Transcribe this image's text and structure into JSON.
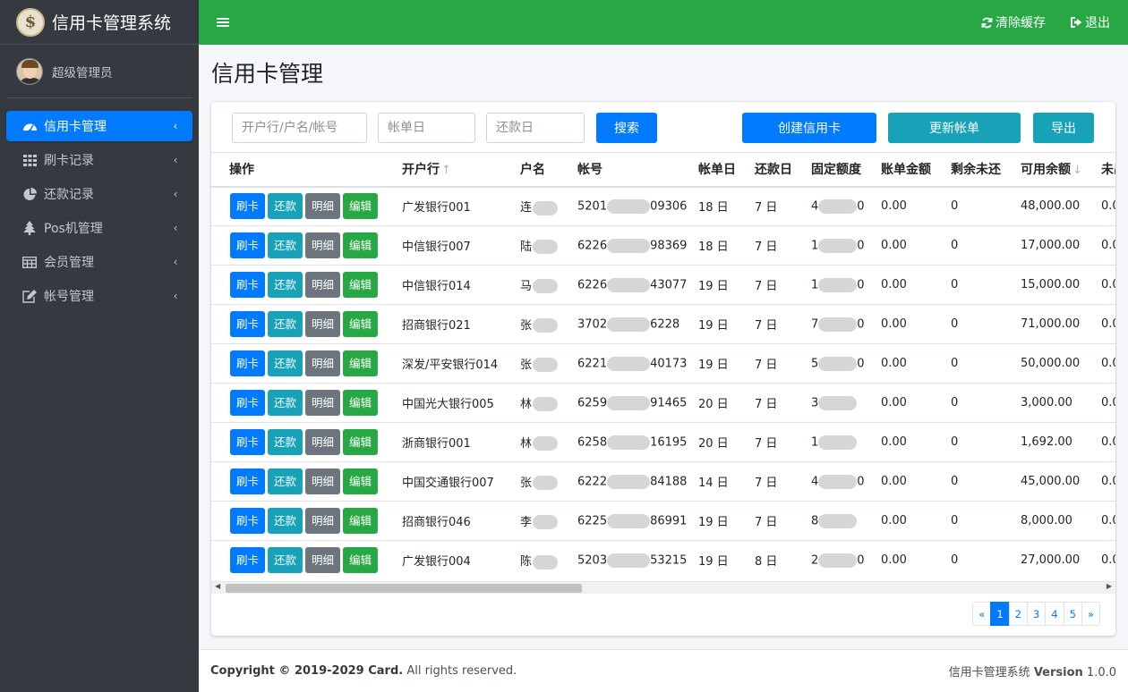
{
  "brand": {
    "title": "信用卡管理系统",
    "logo_icon": "brand-seal-icon"
  },
  "user": {
    "name": "超级管理员"
  },
  "sidebar": {
    "items": [
      {
        "label": "信用卡管理",
        "icon": "dashboard-icon",
        "active": true
      },
      {
        "label": "刷卡记录",
        "icon": "grid-icon",
        "active": false
      },
      {
        "label": "还款记录",
        "icon": "pie-chart-icon",
        "active": false
      },
      {
        "label": "Pos机管理",
        "icon": "tree-icon",
        "active": false
      },
      {
        "label": "会员管理",
        "icon": "table-icon",
        "active": false
      },
      {
        "label": "帐号管理",
        "icon": "edit-icon",
        "active": false
      }
    ]
  },
  "topbar": {
    "clear_cache": "清除缓存",
    "logout": "退出"
  },
  "page": {
    "title": "信用卡管理"
  },
  "toolbar": {
    "search_placeholder": "开户行/户名/帐号",
    "bill_day_placeholder": "帐单日",
    "repay_day_placeholder": "还款日",
    "search_label": "搜索",
    "create_label": "创建信用卡",
    "update_label": "更新帐单",
    "export_label": "导出"
  },
  "table": {
    "headers": [
      "操作",
      "开户行",
      "户名",
      "帐号",
      "帐单日",
      "还款日",
      "固定额度",
      "账单金额",
      "剩余未还",
      "可用余额",
      "未出"
    ],
    "actions": [
      "刷卡",
      "还款",
      "明细",
      "编辑"
    ],
    "rows": [
      {
        "bank": "广发银行001",
        "name": "连",
        "acct_a": "5201",
        "acct_b": "09306",
        "bill_day": "18 日",
        "repay_day": "7 日",
        "limit_a": "4",
        "limit_b": "0",
        "bill_amount": "0.00",
        "remaining": "0",
        "available": "48,000.00",
        "unbilled": "0.0"
      },
      {
        "bank": "中信银行007",
        "name": "陆",
        "acct_a": "6226",
        "acct_b": "98369",
        "bill_day": "18 日",
        "repay_day": "7 日",
        "limit_a": "1",
        "limit_b": "0",
        "bill_amount": "0.00",
        "remaining": "0",
        "available": "17,000.00",
        "unbilled": "0.0"
      },
      {
        "bank": "中信银行014",
        "name": "马",
        "acct_a": "6226",
        "acct_b": "43077",
        "bill_day": "19 日",
        "repay_day": "7 日",
        "limit_a": "1",
        "limit_b": "0",
        "bill_amount": "0.00",
        "remaining": "0",
        "available": "15,000.00",
        "unbilled": "0.0"
      },
      {
        "bank": "招商银行021",
        "name": "张",
        "acct_a": "3702",
        "acct_b": "6228",
        "bill_day": "19 日",
        "repay_day": "7 日",
        "limit_a": "7",
        "limit_b": "0",
        "bill_amount": "0.00",
        "remaining": "0",
        "available": "71,000.00",
        "unbilled": "0.0"
      },
      {
        "bank": "深发/平安银行014",
        "name": "张",
        "acct_a": "6221",
        "acct_b": "40173",
        "bill_day": "19 日",
        "repay_day": "7 日",
        "limit_a": "5",
        "limit_b": "0",
        "bill_amount": "0.00",
        "remaining": "0",
        "available": "50,000.00",
        "unbilled": "0.0"
      },
      {
        "bank": "中国光大银行005",
        "name": "林",
        "acct_a": "6259",
        "acct_b": "91465",
        "bill_day": "20 日",
        "repay_day": "7 日",
        "limit_a": "3",
        "limit_b": "",
        "bill_amount": "0.00",
        "remaining": "0",
        "available": "3,000.00",
        "unbilled": "0.0"
      },
      {
        "bank": "浙商银行001",
        "name": "林",
        "acct_a": "6258",
        "acct_b": "16195",
        "bill_day": "20 日",
        "repay_day": "7 日",
        "limit_a": "1",
        "limit_b": "",
        "bill_amount": "0.00",
        "remaining": "0",
        "available": "1,692.00",
        "unbilled": "0.0"
      },
      {
        "bank": "中国交通银行007",
        "name": "张",
        "acct_a": "6222",
        "acct_b": "84188",
        "bill_day": "14 日",
        "repay_day": "7 日",
        "limit_a": "4",
        "limit_b": "0",
        "bill_amount": "0.00",
        "remaining": "0",
        "available": "45,000.00",
        "unbilled": "0.0"
      },
      {
        "bank": "招商银行046",
        "name": "李",
        "acct_a": "6225",
        "acct_b": "86991",
        "bill_day": "19 日",
        "repay_day": "7 日",
        "limit_a": "8",
        "limit_b": "",
        "bill_amount": "0.00",
        "remaining": "0",
        "available": "8,000.00",
        "unbilled": "0.0"
      },
      {
        "bank": "广发银行004",
        "name": "陈",
        "acct_a": "5203",
        "acct_b": "53215",
        "bill_day": "19 日",
        "repay_day": "8 日",
        "limit_a": "2",
        "limit_b": "0",
        "bill_amount": "0.00",
        "remaining": "0",
        "available": "27,000.00",
        "unbilled": "0.0"
      }
    ]
  },
  "pagination": {
    "prev": "«",
    "pages": [
      "1",
      "2",
      "3",
      "4",
      "5"
    ],
    "current": "1",
    "next": "»"
  },
  "footer": {
    "copyright": "Copyright © 2019-2029 Card.",
    "rights": " All rights reserved.",
    "app": "信用卡管理系统 ",
    "version_label": "Version",
    "version": " 1.0.0"
  },
  "colors": {
    "sidebar": "#343a40",
    "topbar": "#28a745",
    "primary": "#007bff",
    "info": "#17a2b8",
    "secondary": "#6c757d",
    "success": "#28a745"
  }
}
